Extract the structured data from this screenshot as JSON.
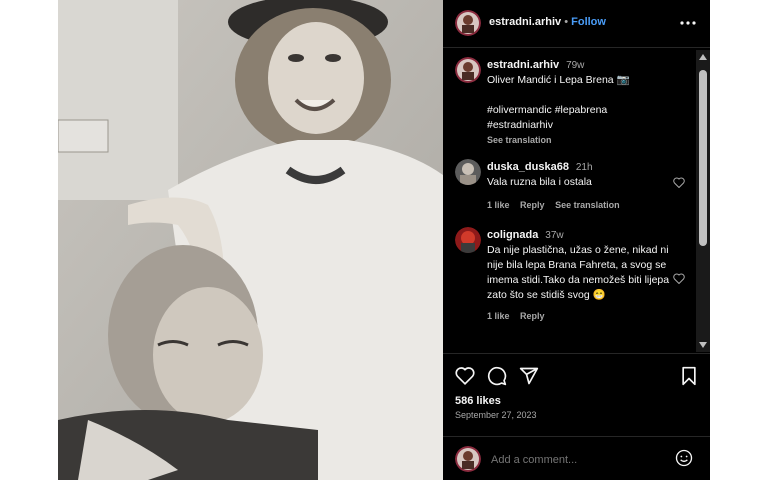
{
  "post": {
    "username": "estradni.arhiv",
    "separator": "•",
    "follow_label": "Follow",
    "more_icon": "more-horizontal-icon"
  },
  "caption": {
    "username": "estradni.arhiv",
    "time": "79w",
    "text": "Oliver Mandić i Lepa Brena 📷",
    "hashtag1": "#olivermandic #lepabrena",
    "hashtag2": "#estradniarhiv",
    "see_translation": "See translation"
  },
  "comments": [
    {
      "username": "duska_duska68",
      "time": "21h",
      "text": "Vala ruzna bila i ostala",
      "likes": "1 like",
      "reply": "Reply",
      "see_translation": "See translation"
    },
    {
      "username": "colignada",
      "time": "37w",
      "text": "Da nije plastična, užas o žene, nikad ni nije bila lepa Brana Fahreta, a svog se imema stidi.Tako da nemožeš biti lijepa zato što se stidiš svog 😁",
      "likes": "1 like",
      "reply": "Reply"
    }
  ],
  "actions": {
    "likes": "586 likes",
    "date": "September 27, 2023"
  },
  "add_comment": {
    "placeholder": "Add a comment..."
  }
}
